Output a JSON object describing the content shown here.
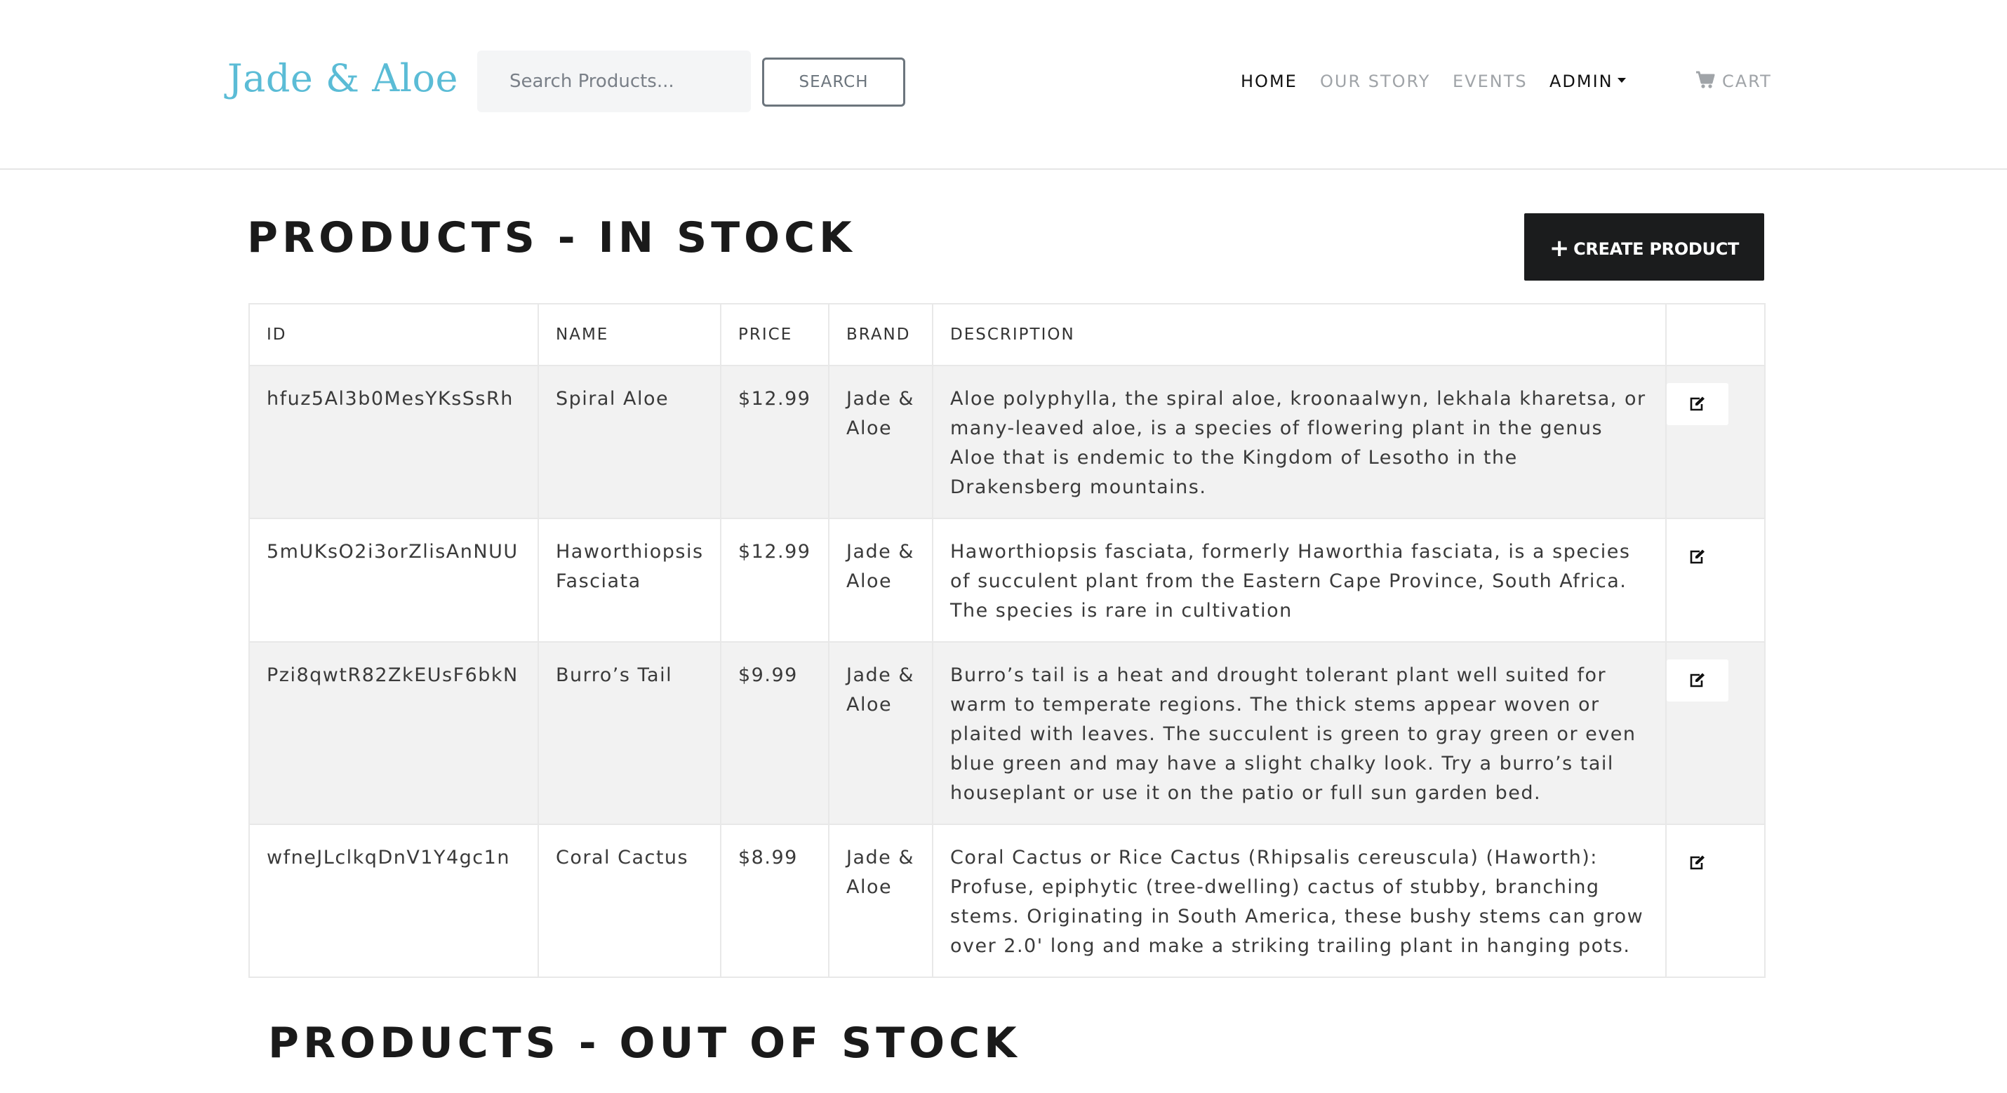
{
  "brand": "Jade & Aloe",
  "search": {
    "placeholder": "Search Products...",
    "button_label": "SEARCH"
  },
  "nav": {
    "home": "HOME",
    "our_story": "OUR STORY",
    "events": "EVENTS",
    "admin": "ADMIN",
    "cart": "CART"
  },
  "in_stock": {
    "heading": "PRODUCTS - IN STOCK",
    "create_label": "CREATE PRODUCT",
    "columns": [
      "ID",
      "NAME",
      "PRICE",
      "BRAND",
      "DESCRIPTION"
    ],
    "rows": [
      {
        "id": "hfuz5Al3b0MesYKsSsRh",
        "name": "Spiral Aloe",
        "price": "$12.99",
        "brand": "Jade & Aloe",
        "description": "Aloe polyphylla, the spiral aloe, kroonaalwyn, lekhala kharetsa, or many-leaved aloe, is a species of flowering plant in the genus Aloe that is endemic to the Kingdom of Lesotho in the Drakensberg mountains."
      },
      {
        "id": "5mUKsO2i3orZlisAnNUU",
        "name": "Haworthiopsis Fasciata",
        "price": "$12.99",
        "brand": "Jade & Aloe",
        "description": "Haworthiopsis fasciata, formerly Haworthia fasciata, is a species of succulent plant from the Eastern Cape Province, South Africa. The species is rare in cultivation"
      },
      {
        "id": "Pzi8qwtR82ZkEUsF6bkN",
        "name": "Burro’s Tail",
        "price": "$9.99",
        "brand": "Jade & Aloe",
        "description": "Burro’s tail is a heat and drought tolerant plant well suited for warm to temperate regions. The thick stems appear woven or plaited with leaves. The succulent is green to gray green or even blue green and may have a slight chalky look. Try a burro’s tail houseplant or use it on the patio or full sun garden bed."
      },
      {
        "id": "wfneJLclkqDnV1Y4gc1n",
        "name": "Coral Cactus",
        "price": "$8.99",
        "brand": "Jade & Aloe",
        "description": "Coral Cactus or Rice Cactus (Rhipsalis cereuscula) (Haworth): Profuse, epiphytic (tree-dwelling) cactus of stubby, branching stems. Originating in South America, these bushy stems can grow over 2.0' long and make a striking trailing plant in hanging pots."
      }
    ]
  },
  "out_of_stock": {
    "heading": "PRODUCTS - OUT OF STOCK"
  },
  "colors": {
    "brand": "#5bbcd6",
    "dark_button": "#1b1c1d",
    "row_stripe": "#f2f2f2",
    "nav_inactive": "#a0a4a8"
  },
  "icons": {
    "cart": "cart-icon",
    "edit": "edit-icon",
    "plus": "plus-icon",
    "caret": "caret-down-icon"
  }
}
